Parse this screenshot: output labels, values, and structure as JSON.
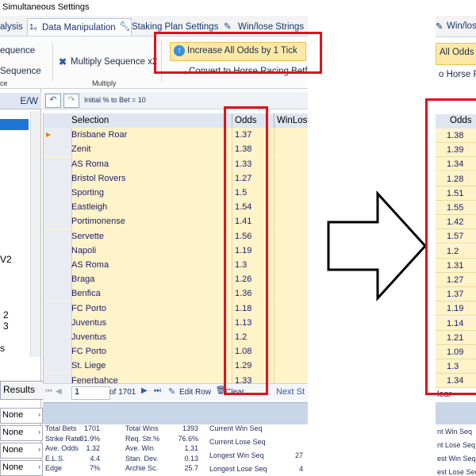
{
  "window": {
    "title": "Simultaneous Settings"
  },
  "tabs": [
    {
      "label": "alysis"
    },
    {
      "label": "Data Manipulation"
    },
    {
      "label": "Staking Plan Settings"
    },
    {
      "label": "Win/lose Strings"
    }
  ],
  "ribbon": {
    "left_items": [
      "equence",
      "Sequence",
      "ce"
    ],
    "multiply_button": "Multiply Sequence x2",
    "multiply_group": "Multiply",
    "increase_button": "Increase All Odds by 1 Tick",
    "convert_button": "Convert to Horse Racing Betfa"
  },
  "left_panel": {
    "header": "E/W",
    "labels": [
      "V2",
      "2",
      "3",
      "s"
    ],
    "results_button": "Results",
    "dropdowns": [
      "None",
      "None",
      "None",
      "None"
    ]
  },
  "toolbar": {
    "initial_pct": "Initial % to Bet = 10"
  },
  "grid": {
    "columns": [
      "Selection",
      "Odds",
      "WinLos"
    ],
    "rows": [
      {
        "selection": "Brisbane Roar",
        "odds": "1.37"
      },
      {
        "selection": "Zenit",
        "odds": "1.38"
      },
      {
        "selection": "AS Roma",
        "odds": "1.33"
      },
      {
        "selection": "Bristol Rovers",
        "odds": "1.27"
      },
      {
        "selection": "Sporting",
        "odds": "1.5"
      },
      {
        "selection": "Eastleigh",
        "odds": "1.54"
      },
      {
        "selection": "Portimonense",
        "odds": "1.41"
      },
      {
        "selection": "Servette",
        "odds": "1.56"
      },
      {
        "selection": "Napoli",
        "odds": "1.19"
      },
      {
        "selection": "AS Roma",
        "odds": "1.3"
      },
      {
        "selection": "Braga",
        "odds": "1.26"
      },
      {
        "selection": "Benfica",
        "odds": "1.36"
      },
      {
        "selection": "FC Porto",
        "odds": "1.18"
      },
      {
        "selection": "Juventus",
        "odds": "1.13"
      },
      {
        "selection": "Juventus",
        "odds": "1.2"
      },
      {
        "selection": "FC Porto",
        "odds": "1.08"
      },
      {
        "selection": "St. Liege",
        "odds": "1.29"
      },
      {
        "selection": "Fenerbahce",
        "odds": "1.33"
      }
    ]
  },
  "nav": {
    "record": "1",
    "of_total": "of 1701",
    "edit_row": "Edit Row",
    "clear": "Clear",
    "next": "Next St"
  },
  "stats": {
    "col1": [
      [
        "Total Bets",
        "1701"
      ],
      [
        "Strike Rate",
        "81.9%"
      ],
      [
        "Ave. Odds",
        "1.32"
      ],
      [
        "E.L.S.",
        "4.4"
      ],
      [
        "Edge",
        "7%"
      ]
    ],
    "col2": [
      [
        "Total Wins",
        "1393"
      ],
      [
        "Req. Str.%",
        "76.6%"
      ],
      [
        "Ave. Win",
        "1.31"
      ],
      [
        "Stan. Dev.",
        "0.13"
      ],
      [
        "Archie Sc.",
        "25.7"
      ]
    ],
    "col3": [
      [
        "Current Win Seq",
        ""
      ],
      [
        "Current Lose Seq",
        ""
      ],
      [
        "Longest Win Seq",
        "27"
      ],
      [
        "Longest Lose Seq",
        "4"
      ]
    ]
  },
  "right": {
    "tab": "Win/los",
    "increase_partial": "All Odds by",
    "convert_partial": "o Horse Ra",
    "odds_header": "Odds",
    "odds": [
      "1.38",
      "1.39",
      "1.34",
      "1.28",
      "1.51",
      "1.55",
      "1.42",
      "1.57",
      "1.2",
      "1.31",
      "1.27",
      "1.37",
      "1.19",
      "1.14",
      "1.21",
      "1.09",
      "1.3",
      "1.34"
    ],
    "clear": "lear",
    "stats": [
      "nt Win Seq",
      "nt Lose Seq",
      "est Win Seq",
      "est Lose Seq"
    ]
  },
  "colors": {
    "accent": "#e01219",
    "odds_highlight": "#fde9a5",
    "grid_row": "#fff3c9"
  }
}
